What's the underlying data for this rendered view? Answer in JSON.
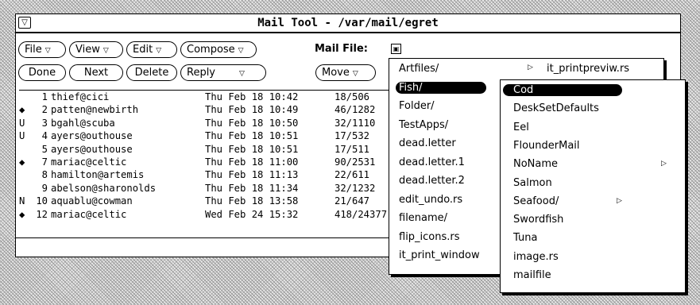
{
  "window": {
    "title": "Mail Tool - /var/mail/egret",
    "menu_glyph": "▽"
  },
  "toolbar": {
    "row1": [
      {
        "label": "File",
        "tri": "▽"
      },
      {
        "label": "View",
        "tri": "▽"
      },
      {
        "label": "Edit",
        "tri": "▽"
      },
      {
        "label": "Compose",
        "tri": "▽"
      }
    ],
    "mail_file_label": "Mail File:",
    "mail_file_glyph": "▣",
    "row2": [
      {
        "label": "Done"
      },
      {
        "label": "Next"
      },
      {
        "label": "Delete"
      },
      {
        "label": "Reply",
        "tri": "▽"
      },
      {
        "label": "Move",
        "tri": "▽"
      }
    ]
  },
  "messages": [
    {
      "flag": "",
      "num": "1",
      "from": "thief@cici",
      "date": "Thu Feb 18 10:42",
      "size": "18/506"
    },
    {
      "flag": "◆",
      "num": "2",
      "from": "patten@newbirth",
      "date": "Thu Feb 18 10:49",
      "size": "46/1282"
    },
    {
      "flag": "U",
      "num": "3",
      "from": "bgahl@scuba",
      "date": "Thu Feb 18 10:50",
      "size": "32/1110"
    },
    {
      "flag": "U",
      "num": "4",
      "from": "ayers@outhouse",
      "date": "Thu Feb 18 10:51",
      "size": "17/532"
    },
    {
      "flag": "",
      "num": "5",
      "from": "ayers@outhouse",
      "date": "Thu Feb 18 10:51",
      "size": "17/511"
    },
    {
      "flag": "◆",
      "num": "7",
      "from": "mariac@celtic",
      "date": "Thu Feb 18 11:00",
      "size": "90/2531"
    },
    {
      "flag": "",
      "num": "8",
      "from": "hamilton@artemis",
      "date": "Thu Feb 18 11:13",
      "size": "22/611"
    },
    {
      "flag": "",
      "num": "9",
      "from": "abelson@sharonolds",
      "date": "Thu Feb 18 11:34",
      "size": "32/1232"
    },
    {
      "flag": "N",
      "num": "10",
      "from": "aquablu@cowman",
      "date": "Thu Feb 18 13:58",
      "size": "21/647"
    },
    {
      "flag": "◆",
      "num": "12",
      "from": "mariac@celtic",
      "date": "Wed Feb 24 15:32",
      "size": "418/24377"
    }
  ],
  "menu1": {
    "items": [
      "Artfiles/",
      "Fish/",
      "Folder/",
      "TestApps/",
      "dead.letter",
      "dead.letter.1",
      "dead.letter.2",
      "edit_undo.rs",
      "filename/",
      "flip_icons.rs",
      "it_print_window"
    ],
    "submenu_glyph": "▷"
  },
  "menu1_right": {
    "top_item": "it_printpreviw.rs",
    "glyph": "▷",
    "partial_1": "@",
    "partial_2": "rs"
  },
  "menu2": {
    "items": [
      "Cod",
      "DeskSetDefaults",
      "Eel",
      "FlounderMail",
      "NoName",
      "Salmon",
      "Seafood/",
      "Swordfish",
      "Tuna",
      "image.rs",
      "mailfile"
    ],
    "submenu_glyph": "▷"
  }
}
